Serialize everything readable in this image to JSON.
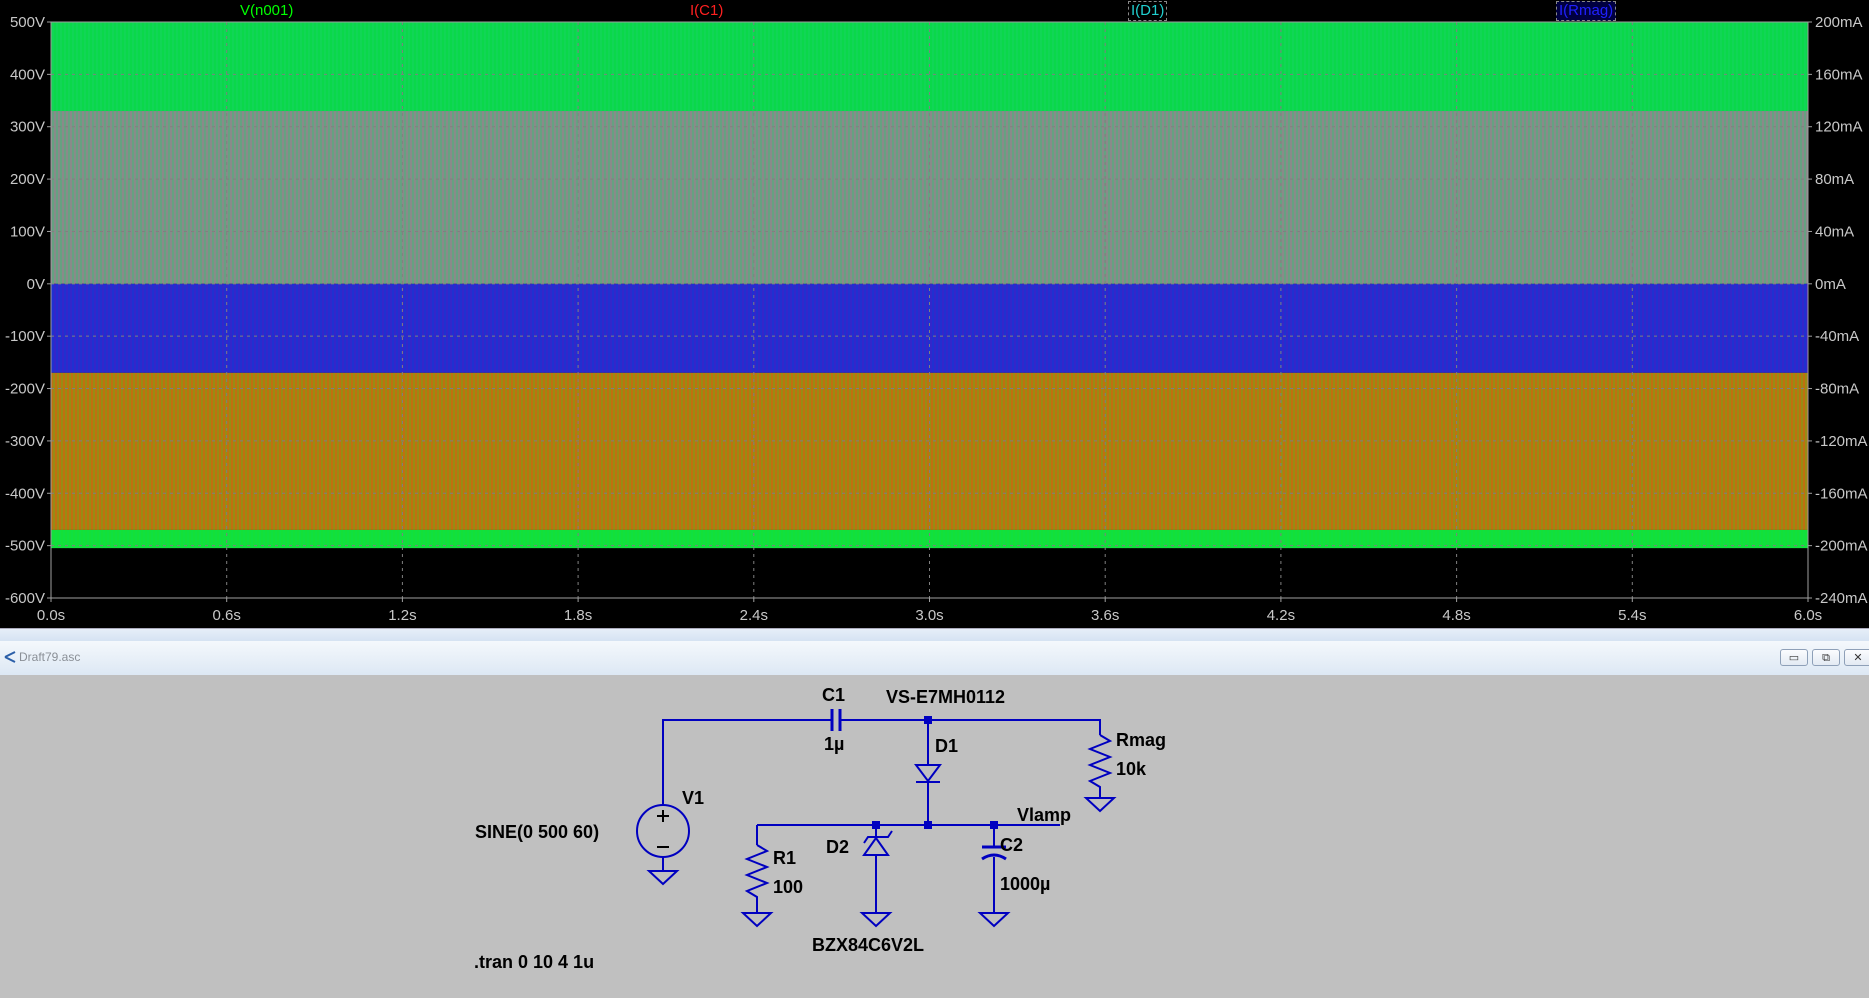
{
  "plot": {
    "traces": [
      {
        "name": "V(n001)",
        "color": "#00ff00"
      },
      {
        "name": "I(C1)",
        "color": "#ff2020"
      },
      {
        "name": "I(D1)",
        "color": "#20d0d0"
      },
      {
        "name": "I(Rmag)",
        "color": "#2020ff"
      }
    ],
    "left_axis": [
      "500V",
      "400V",
      "300V",
      "200V",
      "100V",
      "0V",
      "-100V",
      "-200V",
      "-300V",
      "-400V",
      "-500V",
      "-600V"
    ],
    "right_axis": [
      "200mA",
      "160mA",
      "120mA",
      "80mA",
      "40mA",
      "0mA",
      "-40mA",
      "-80mA",
      "-120mA",
      "-160mA",
      "-200mA",
      "-240mA"
    ],
    "x_axis": [
      "0.0s",
      "0.6s",
      "1.2s",
      "1.8s",
      "2.4s",
      "3.0s",
      "3.6s",
      "4.2s",
      "4.8s",
      "5.4s",
      "6.0s"
    ]
  },
  "schematic_window": {
    "title": "Draft79.asc",
    "minimize_label": "▭",
    "restore_label": "⧉",
    "close_label": "✕"
  },
  "schematic": {
    "c1_name": "C1",
    "c1_value": "1µ",
    "d1_model": "VS-E7MH0112",
    "d1_name": "D1",
    "rmag_name": "Rmag",
    "rmag_value": "10k",
    "v1_name": "V1",
    "v1_value": "SINE(0 500 60)",
    "vlamp_label": "Vlamp",
    "r1_name": "R1",
    "r1_value": "100",
    "d2_name": "D2",
    "d2_model": "BZX84C6V2L",
    "c2_name": "C2",
    "c2_value": "1000µ",
    "directive": ".tran 0 10 4 1u"
  },
  "colors": {
    "plot_bg": "#000000",
    "grid": "#808080",
    "wire": "#0000c0",
    "schematic_bg": "#c0c0c0"
  }
}
